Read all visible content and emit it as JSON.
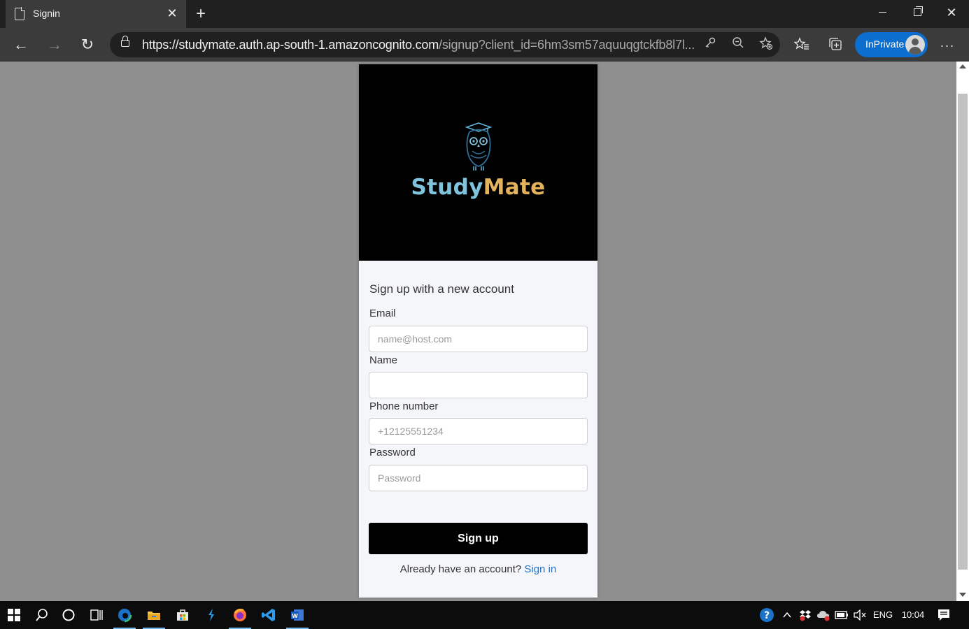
{
  "browser": {
    "tab_title": "Signin",
    "url_host": "https://studymate.auth.ap-south-1.amazoncognito.com",
    "url_rest": "/signup?client_id=6hm3sm57aquuqgtckfb8l7l...",
    "inprivate_label": "InPrivate",
    "accent_color": "#0c6fd0"
  },
  "brand": {
    "name_part1": "Study",
    "name_part2": "Mate",
    "color_part1": "#7fc3dd",
    "color_part2": "#e2b25c"
  },
  "form": {
    "title": "Sign up with a new account",
    "email": {
      "label": "Email",
      "placeholder": "name@host.com",
      "value": ""
    },
    "name": {
      "label": "Name",
      "placeholder": "",
      "value": ""
    },
    "phone": {
      "label": "Phone number",
      "placeholder": "+12125551234",
      "value": ""
    },
    "password": {
      "label": "Password",
      "placeholder": "Password",
      "value": ""
    },
    "submit_label": "Sign up",
    "already_text": "Already have an account?",
    "signin_link": "Sign in"
  },
  "taskbar": {
    "language": "ENG",
    "time": "10:04",
    "apps": [
      "start",
      "search",
      "cortana",
      "task-view",
      "edge",
      "file-explorer",
      "store",
      "visual-studio",
      "firefox",
      "vscode",
      "word"
    ]
  }
}
